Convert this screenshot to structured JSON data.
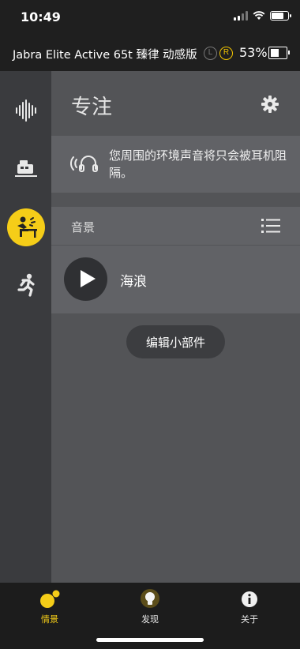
{
  "status_bar": {
    "time": "10:49"
  },
  "device": {
    "name": "Jabra Elite Active 65t 臻律 动感版",
    "left_badge": "L",
    "right_badge": "R",
    "battery_percent": "53%",
    "battery_level": 0.53
  },
  "sidebar": {
    "items": [
      {
        "icon": "soundwave-icon",
        "active": false
      },
      {
        "icon": "commute-icon",
        "active": false
      },
      {
        "icon": "focus-icon",
        "active": true
      },
      {
        "icon": "running-icon",
        "active": false
      }
    ]
  },
  "main": {
    "title": "专注",
    "info_text": "您周围的环境声音将只会被耳机阻隔。",
    "soundscape_label": "音景",
    "sound_name": "海浪",
    "edit_widget_label": "编辑小部件"
  },
  "tabbar": {
    "tabs": [
      {
        "label": "情景",
        "icon": "moments-icon",
        "active": true
      },
      {
        "label": "发现",
        "icon": "discover-icon",
        "active": false
      },
      {
        "label": "关于",
        "icon": "info-icon",
        "active": false
      }
    ]
  },
  "colors": {
    "accent": "#f5cd18",
    "sidebar": "#3a3b3e",
    "panel": "#535457",
    "card": "#616266"
  }
}
